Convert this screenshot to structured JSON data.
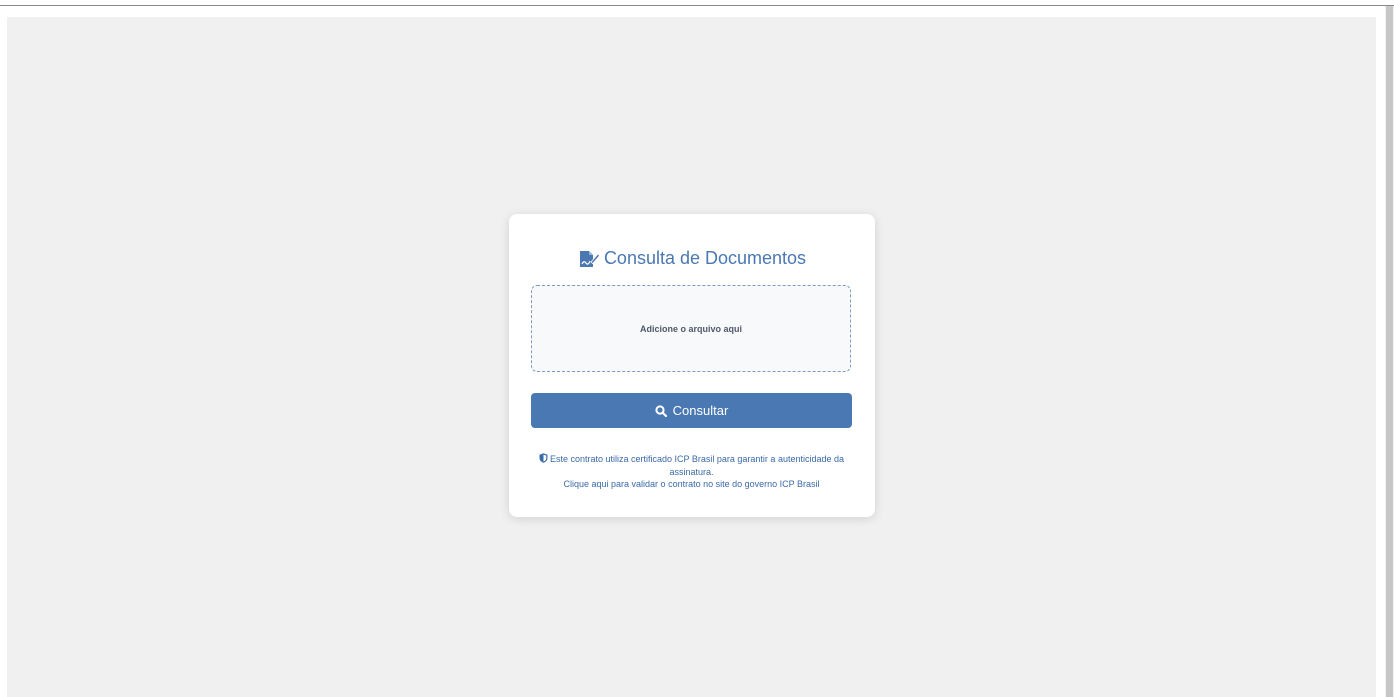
{
  "card": {
    "title": "Consulta de Documentos",
    "title_icon": "file-signature-icon",
    "dropzone_label": "Adicione o arquivo aqui",
    "submit_label": "Consultar",
    "submit_icon": "search-icon",
    "notice_text": "Este contrato utiliza certificado ICP Brasil para garantir a autenticidade da assinatura.",
    "notice_icon": "shield-icon",
    "validate_link": "Clique aqui para validar o contrato no site do governo ICP Brasil"
  },
  "colors": {
    "accent": "#4a78b3",
    "background": "#f0f0f0",
    "card": "#ffffff"
  }
}
